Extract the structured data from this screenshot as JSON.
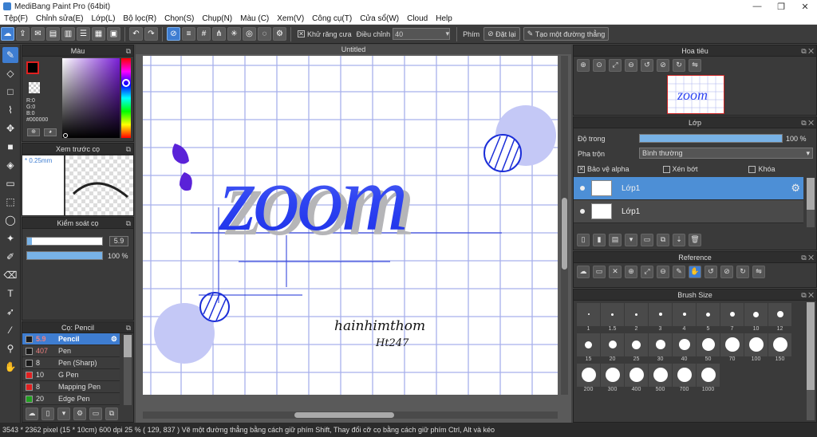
{
  "window": {
    "title": "MediBang Paint Pro (64bit)",
    "controls": [
      "—",
      "❐",
      "✕"
    ]
  },
  "menu": [
    "Tệp(F)",
    "Chỉnh sửa(E)",
    "Lớp(L)",
    "Bộ lọc(R)",
    "Chọn(S)",
    "Chụp(N)",
    "Màu (C)",
    "Xem(V)",
    "Công cụ(T)",
    "Cửa sổ(W)",
    "Cloud",
    "Help"
  ],
  "toolbar": {
    "antialias_label": "Khử răng cưa",
    "antialias_checked": "✕",
    "correction_label": "Điều chỉnh",
    "correction_value": "40",
    "button_label": "Phím",
    "reset_label": "Đặt lại",
    "line_label": "Tạo một đường thẳng"
  },
  "panels": {
    "color": {
      "title": "Màu",
      "r": "R:0",
      "g": "G:0",
      "b": "B:0",
      "hex": "#000000"
    },
    "preview": {
      "title": "Xem trước cọ",
      "size": "* 0.25mm"
    },
    "brush_control": {
      "title": "Kiểm soát cọ",
      "size_value": "5.9",
      "opacity_value": "100 %",
      "size_fill": 0.06,
      "opacity_fill": 1.0
    },
    "brush_list": {
      "title": "Cọ: Pencil",
      "items": [
        {
          "size": "5.9",
          "name": "Pencil",
          "color": "#1a1a1a",
          "selected": true
        },
        {
          "size": "407",
          "name": "Pen",
          "color": "#1a1a1a",
          "selected": false
        },
        {
          "size": "8",
          "name": "Pen (Sharp)",
          "color": "#1a1a1a",
          "selected": false
        },
        {
          "size": "10",
          "name": "G Pen",
          "color": "#e02020",
          "selected": false
        },
        {
          "size": "8",
          "name": "Mapping Pen",
          "color": "#e02020",
          "selected": false
        },
        {
          "size": "20",
          "name": "Edge Pen",
          "color": "#20a020",
          "selected": false
        }
      ]
    },
    "navigator": {
      "title": "Hoa tiêu"
    },
    "layer": {
      "title": "Lớp",
      "opacity_label": "Độ trong",
      "opacity_value": "100 %",
      "opacity_fill": 1.0,
      "blend_label": "Pha trộn",
      "blend_value": "Bình thường",
      "protect_alpha": "Bảo vệ alpha",
      "clipping": "Xén bớt",
      "lock": "Khóa",
      "layers": [
        {
          "name": "Lớp1",
          "selected": true
        },
        {
          "name": "Lớp1",
          "selected": false
        }
      ]
    },
    "reference": {
      "title": "Reference"
    },
    "brush_size": {
      "title": "Brush Size",
      "sizes": [
        "1",
        "1.5",
        "2",
        "3",
        "4",
        "5",
        "7",
        "10",
        "12",
        "15",
        "20",
        "25",
        "30",
        "40",
        "50",
        "70",
        "100",
        "150",
        "200",
        "300",
        "400",
        "500",
        "700",
        "1000"
      ]
    }
  },
  "document": {
    "tab": "Untitled",
    "artwork_text": "zoom",
    "signature_line1": "hainhimthom",
    "signature_line2": "Ht247"
  },
  "status": {
    "text": "3543 * 2362 pixel   (15 * 10cm)   600 dpi   25 %   ( 129, 837 )   Vẽ một đường thẳng bằng cách giữ phím Shift, Thay đổi cỡ cọ bằng cách giữ phím Ctrl, Alt và kéo"
  },
  "colors": {
    "accent": "#3e7dd1",
    "ink": "#2b3ef0",
    "grid": "#8c96e6"
  }
}
